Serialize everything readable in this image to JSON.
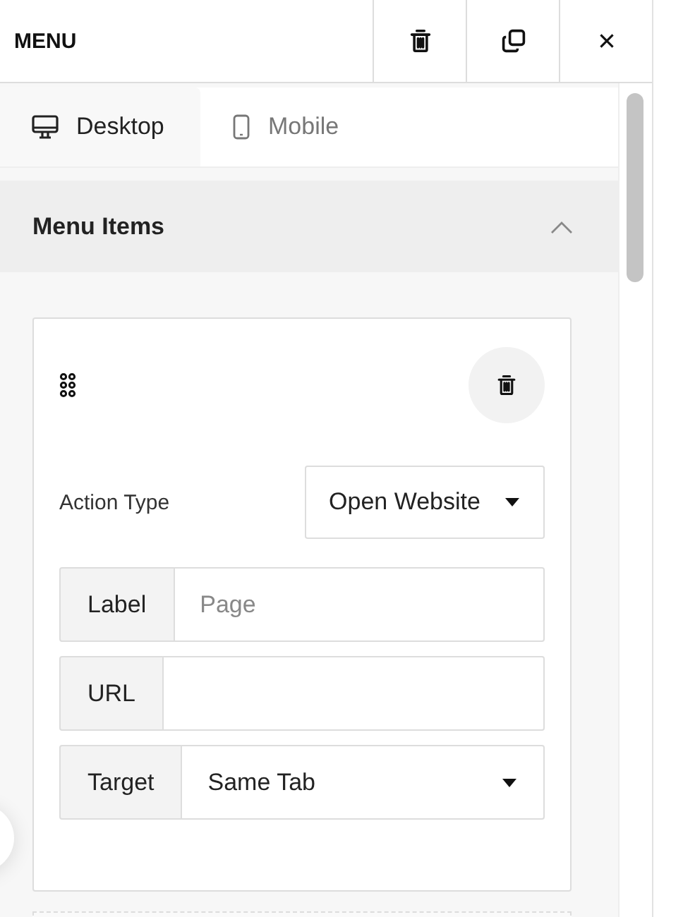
{
  "header": {
    "title": "MENU"
  },
  "tabs": [
    {
      "label": "Desktop",
      "kind": "desktop",
      "selected": true
    },
    {
      "label": "Mobile",
      "kind": "mobile",
      "selected": false
    }
  ],
  "section": {
    "title": "Menu Items",
    "expanded": true
  },
  "item": {
    "action_type": {
      "label": "Action Type",
      "value": "Open Website"
    },
    "fields": [
      {
        "label": "Label",
        "kind": "input",
        "placeholder": "Page"
      },
      {
        "label": "URL",
        "kind": "input"
      },
      {
        "label": "Target",
        "kind": "select",
        "value": "Same Tab"
      }
    ]
  }
}
